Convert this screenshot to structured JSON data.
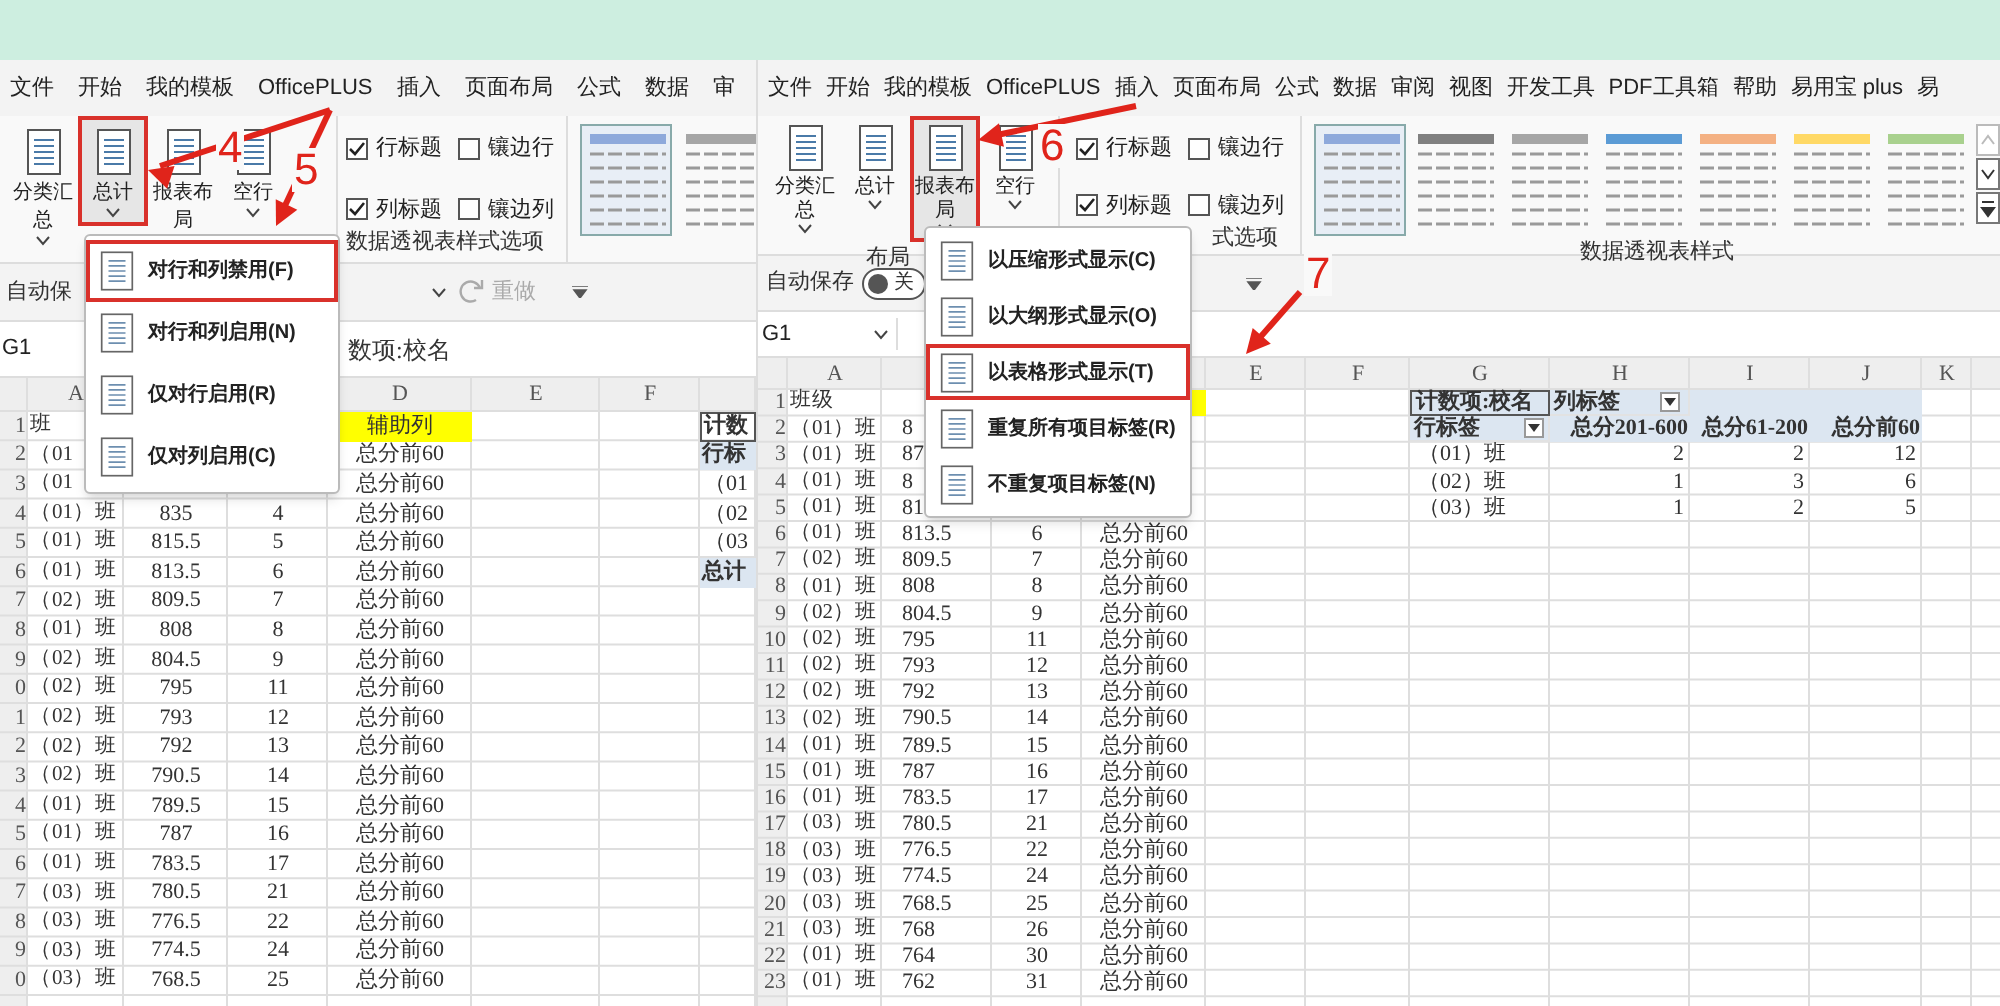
{
  "annotations": [
    {
      "label": "4"
    },
    {
      "label": "5"
    },
    {
      "label": "6"
    },
    {
      "label": "7"
    }
  ],
  "left_window": {
    "menu": [
      "文件",
      "开始",
      "我的模板",
      "OfficePLUS",
      "插入",
      "页面布局",
      "公式",
      "数据",
      "审"
    ],
    "ribbon_buttons": [
      {
        "label": "分类汇总",
        "highlighted": false
      },
      {
        "label": "总计",
        "highlighted": true
      },
      {
        "label": "报表布局",
        "highlighted": false
      },
      {
        "label": "空行",
        "highlighted": false
      }
    ],
    "checkboxes": [
      {
        "label": "行标题",
        "checked": true
      },
      {
        "label": "镶边行",
        "checked": false
      },
      {
        "label": "列标题",
        "checked": true
      },
      {
        "label": "镶边列",
        "checked": false
      }
    ],
    "options_group_label": "数据透视表样式选项",
    "styles": [
      {
        "selected": true,
        "color": "#8ea9db"
      },
      {
        "selected": false,
        "color": "#a6a6a6"
      }
    ],
    "quick_access": {
      "autosave": "自动保",
      "redo": "重做"
    },
    "name_box": "G1",
    "formula": "数项:校名",
    "dropdown": [
      {
        "label": "对行和列禁用(F)",
        "highlighted": true
      },
      {
        "label": "对行和列启用(N)",
        "highlighted": false
      },
      {
        "label": "仅对行启用(R)",
        "highlighted": false
      },
      {
        "label": "仅对列启用(C)",
        "highlighted": false
      }
    ],
    "column_headers": [
      "A",
      "D",
      "E",
      "F"
    ],
    "rows": [
      {
        "number": "1",
        "cells": [
          "班",
          "",
          "",
          "辅助列"
        ]
      },
      {
        "number": "2",
        "cells": [
          "（01",
          "",
          "",
          "总分前60"
        ]
      },
      {
        "number": "3",
        "cells": [
          "（01",
          "",
          "",
          "总分前60"
        ]
      },
      {
        "number": "4",
        "cells": [
          "（01）班",
          "835",
          "4",
          "总分前60"
        ]
      },
      {
        "number": "5",
        "cells": [
          "（01）班",
          "815.5",
          "5",
          "总分前60"
        ]
      },
      {
        "number": "6",
        "cells": [
          "（01）班",
          "813.5",
          "6",
          "总分前60"
        ]
      },
      {
        "number": "7",
        "cells": [
          "（02）班",
          "809.5",
          "7",
          "总分前60"
        ]
      },
      {
        "number": "8",
        "cells": [
          "（01）班",
          "808",
          "8",
          "总分前60"
        ]
      },
      {
        "number": "9",
        "cells": [
          "（02）班",
          "804.5",
          "9",
          "总分前60"
        ]
      },
      {
        "number": "0",
        "cells": [
          "（02）班",
          "795",
          "11",
          "总分前60"
        ]
      },
      {
        "number": "1",
        "cells": [
          "（02）班",
          "793",
          "12",
          "总分前60"
        ]
      },
      {
        "number": "2",
        "cells": [
          "（02）班",
          "792",
          "13",
          "总分前60"
        ]
      },
      {
        "number": "3",
        "cells": [
          "（02）班",
          "790.5",
          "14",
          "总分前60"
        ]
      },
      {
        "number": "4",
        "cells": [
          "（01）班",
          "789.5",
          "15",
          "总分前60"
        ]
      },
      {
        "number": "5",
        "cells": [
          "（01）班",
          "787",
          "16",
          "总分前60"
        ]
      },
      {
        "number": "6",
        "cells": [
          "（01）班",
          "783.5",
          "17",
          "总分前60"
        ]
      },
      {
        "number": "7",
        "cells": [
          "（03）班",
          "780.5",
          "21",
          "总分前60"
        ]
      },
      {
        "number": "8",
        "cells": [
          "（03）班",
          "776.5",
          "22",
          "总分前60"
        ]
      },
      {
        "number": "9",
        "cells": [
          "（03）班",
          "774.5",
          "24",
          "总分前60"
        ]
      },
      {
        "number": "0",
        "cells": [
          "（03）班",
          "768.5",
          "25",
          "总分前60"
        ]
      }
    ],
    "pivot_partial": [
      {
        "text": "计数",
        "kind": "corner"
      },
      {
        "text": "行标",
        "kind": "header"
      },
      {
        "text": "（01",
        "kind": "item"
      },
      {
        "text": "（02",
        "kind": "item"
      },
      {
        "text": "（03",
        "kind": "item"
      },
      {
        "text": "总计",
        "kind": "total"
      }
    ]
  },
  "right_window": {
    "menu": [
      "文件",
      "开始",
      "我的模板",
      "OfficePLUS",
      "插入",
      "页面布局",
      "公式",
      "数据",
      "审阅",
      "视图",
      "开发工具",
      "PDF工具箱",
      "帮助",
      "易用宝 plus",
      "易"
    ],
    "ribbon_buttons": [
      {
        "label": "分类汇总",
        "highlighted": false
      },
      {
        "label": "总计",
        "highlighted": false
      },
      {
        "label": "报表布局",
        "highlighted": true
      },
      {
        "label": "空行",
        "highlighted": false
      }
    ],
    "checkboxes": [
      {
        "label": "行标题",
        "checked": true
      },
      {
        "label": "镶边行",
        "checked": false
      },
      {
        "label": "列标题",
        "checked": true
      },
      {
        "label": "镶边列",
        "checked": false
      }
    ],
    "layout_group_label": "布局",
    "options_group_label": "式选项",
    "styles_group_label": "数据透视表样式",
    "styles": [
      {
        "selected": true,
        "color": "#8ea9db"
      },
      {
        "selected": false,
        "color": "#808080"
      },
      {
        "selected": false,
        "color": "#a6a6a6"
      },
      {
        "selected": false,
        "color": "#5b9bd5"
      },
      {
        "selected": false,
        "color": "#f4b183"
      },
      {
        "selected": false,
        "color": "#ffd966"
      },
      {
        "selected": false,
        "color": "#a9d18e"
      }
    ],
    "quick_access": {
      "autosave": "自动保存",
      "autosave_on": false,
      "toggle_text": "关"
    },
    "name_box": "G1",
    "dropdown": [
      {
        "label": "以压缩形式显示(C)",
        "highlighted": false
      },
      {
        "label": "以大纲形式显示(O)",
        "highlighted": false
      },
      {
        "label": "以表格形式显示(T)",
        "highlighted": true
      },
      {
        "label": "重复所有项目标签(R)",
        "highlighted": false
      },
      {
        "label": "不重复项目标签(N)",
        "highlighted": false
      }
    ],
    "column_headers": [
      "A",
      "E",
      "F",
      "G",
      "H",
      "I",
      "J",
      "K"
    ],
    "rows": [
      {
        "number": "1",
        "cells": [
          "班级",
          "",
          "",
          ""
        ]
      },
      {
        "number": "2",
        "cells": [
          "（01）班",
          "8",
          "",
          ""
        ]
      },
      {
        "number": "3",
        "cells": [
          "（01）班",
          "87",
          "",
          ""
        ]
      },
      {
        "number": "4",
        "cells": [
          "（01）班",
          "8",
          "",
          ""
        ]
      },
      {
        "number": "5",
        "cells": [
          "（01）班",
          "81",
          "",
          ""
        ]
      },
      {
        "number": "6",
        "cells": [
          "（01）班",
          "813.5",
          "6",
          "总分前60"
        ]
      },
      {
        "number": "7",
        "cells": [
          "（02）班",
          "809.5",
          "7",
          "总分前60"
        ]
      },
      {
        "number": "8",
        "cells": [
          "（01）班",
          "808",
          "8",
          "总分前60"
        ]
      },
      {
        "number": "9",
        "cells": [
          "（02）班",
          "804.5",
          "9",
          "总分前60"
        ]
      },
      {
        "number": "10",
        "cells": [
          "（02）班",
          "795",
          "11",
          "总分前60"
        ]
      },
      {
        "number": "11",
        "cells": [
          "（02）班",
          "793",
          "12",
          "总分前60"
        ]
      },
      {
        "number": "12",
        "cells": [
          "（02）班",
          "792",
          "13",
          "总分前60"
        ]
      },
      {
        "number": "13",
        "cells": [
          "（02）班",
          "790.5",
          "14",
          "总分前60"
        ]
      },
      {
        "number": "14",
        "cells": [
          "（01）班",
          "789.5",
          "15",
          "总分前60"
        ]
      },
      {
        "number": "15",
        "cells": [
          "（01）班",
          "787",
          "16",
          "总分前60"
        ]
      },
      {
        "number": "16",
        "cells": [
          "（01）班",
          "783.5",
          "17",
          "总分前60"
        ]
      },
      {
        "number": "17",
        "cells": [
          "（03）班",
          "780.5",
          "21",
          "总分前60"
        ]
      },
      {
        "number": "18",
        "cells": [
          "（03）班",
          "776.5",
          "22",
          "总分前60"
        ]
      },
      {
        "number": "19",
        "cells": [
          "（03）班",
          "774.5",
          "24",
          "总分前60"
        ]
      },
      {
        "number": "20",
        "cells": [
          "（03）班",
          "768.5",
          "25",
          "总分前60"
        ]
      },
      {
        "number": "21",
        "cells": [
          "（03）班",
          "768",
          "26",
          "总分前60"
        ]
      },
      {
        "number": "22",
        "cells": [
          "（01）班",
          "764",
          "30",
          "总分前60"
        ]
      },
      {
        "number": "23",
        "cells": [
          "（01）班",
          "762",
          "31",
          "总分前60"
        ]
      }
    ],
    "pivot": {
      "corner": "计数项:校名",
      "column_label": "列标签",
      "row_label": "行标签",
      "columns": [
        "总分201-600",
        "总分61-200",
        "总分前60"
      ],
      "rows": [
        {
          "label": "（01）班",
          "values": [
            "2",
            "2",
            "12"
          ]
        },
        {
          "label": "（02）班",
          "values": [
            "1",
            "3",
            "6"
          ]
        },
        {
          "label": "（03）班",
          "values": [
            "1",
            "2",
            "5"
          ]
        }
      ]
    }
  }
}
